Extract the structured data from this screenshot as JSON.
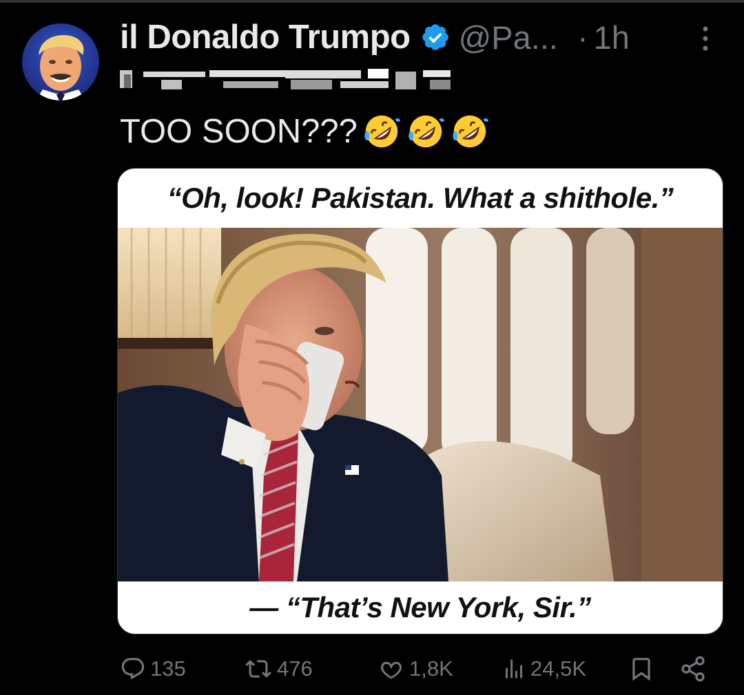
{
  "tweet": {
    "author": {
      "display_name": "il Donaldo Trumpo",
      "handle": "@Pa...",
      "verified": true,
      "avatar_icon": "profile-avatar-photo"
    },
    "separator": "·",
    "timestamp": "1h",
    "text": "TOO SOON???",
    "emojis": [
      "rolling-on-floor-laughing-emoji",
      "rolling-on-floor-laughing-emoji",
      "rolling-on-floor-laughing-emoji"
    ],
    "media": {
      "caption_top": "“Oh, look! Pakistan. What a shithole.”",
      "caption_bottom": "— “That’s New York, Sir.”"
    },
    "stats": {
      "replies": "135",
      "reposts": "476",
      "likes": "1,8K",
      "views": "24,5K"
    }
  },
  "colors": {
    "background": "#000000",
    "text_primary": "#e7e9ea",
    "text_secondary": "#71767b",
    "verified_blue": "#1d9bf0"
  }
}
